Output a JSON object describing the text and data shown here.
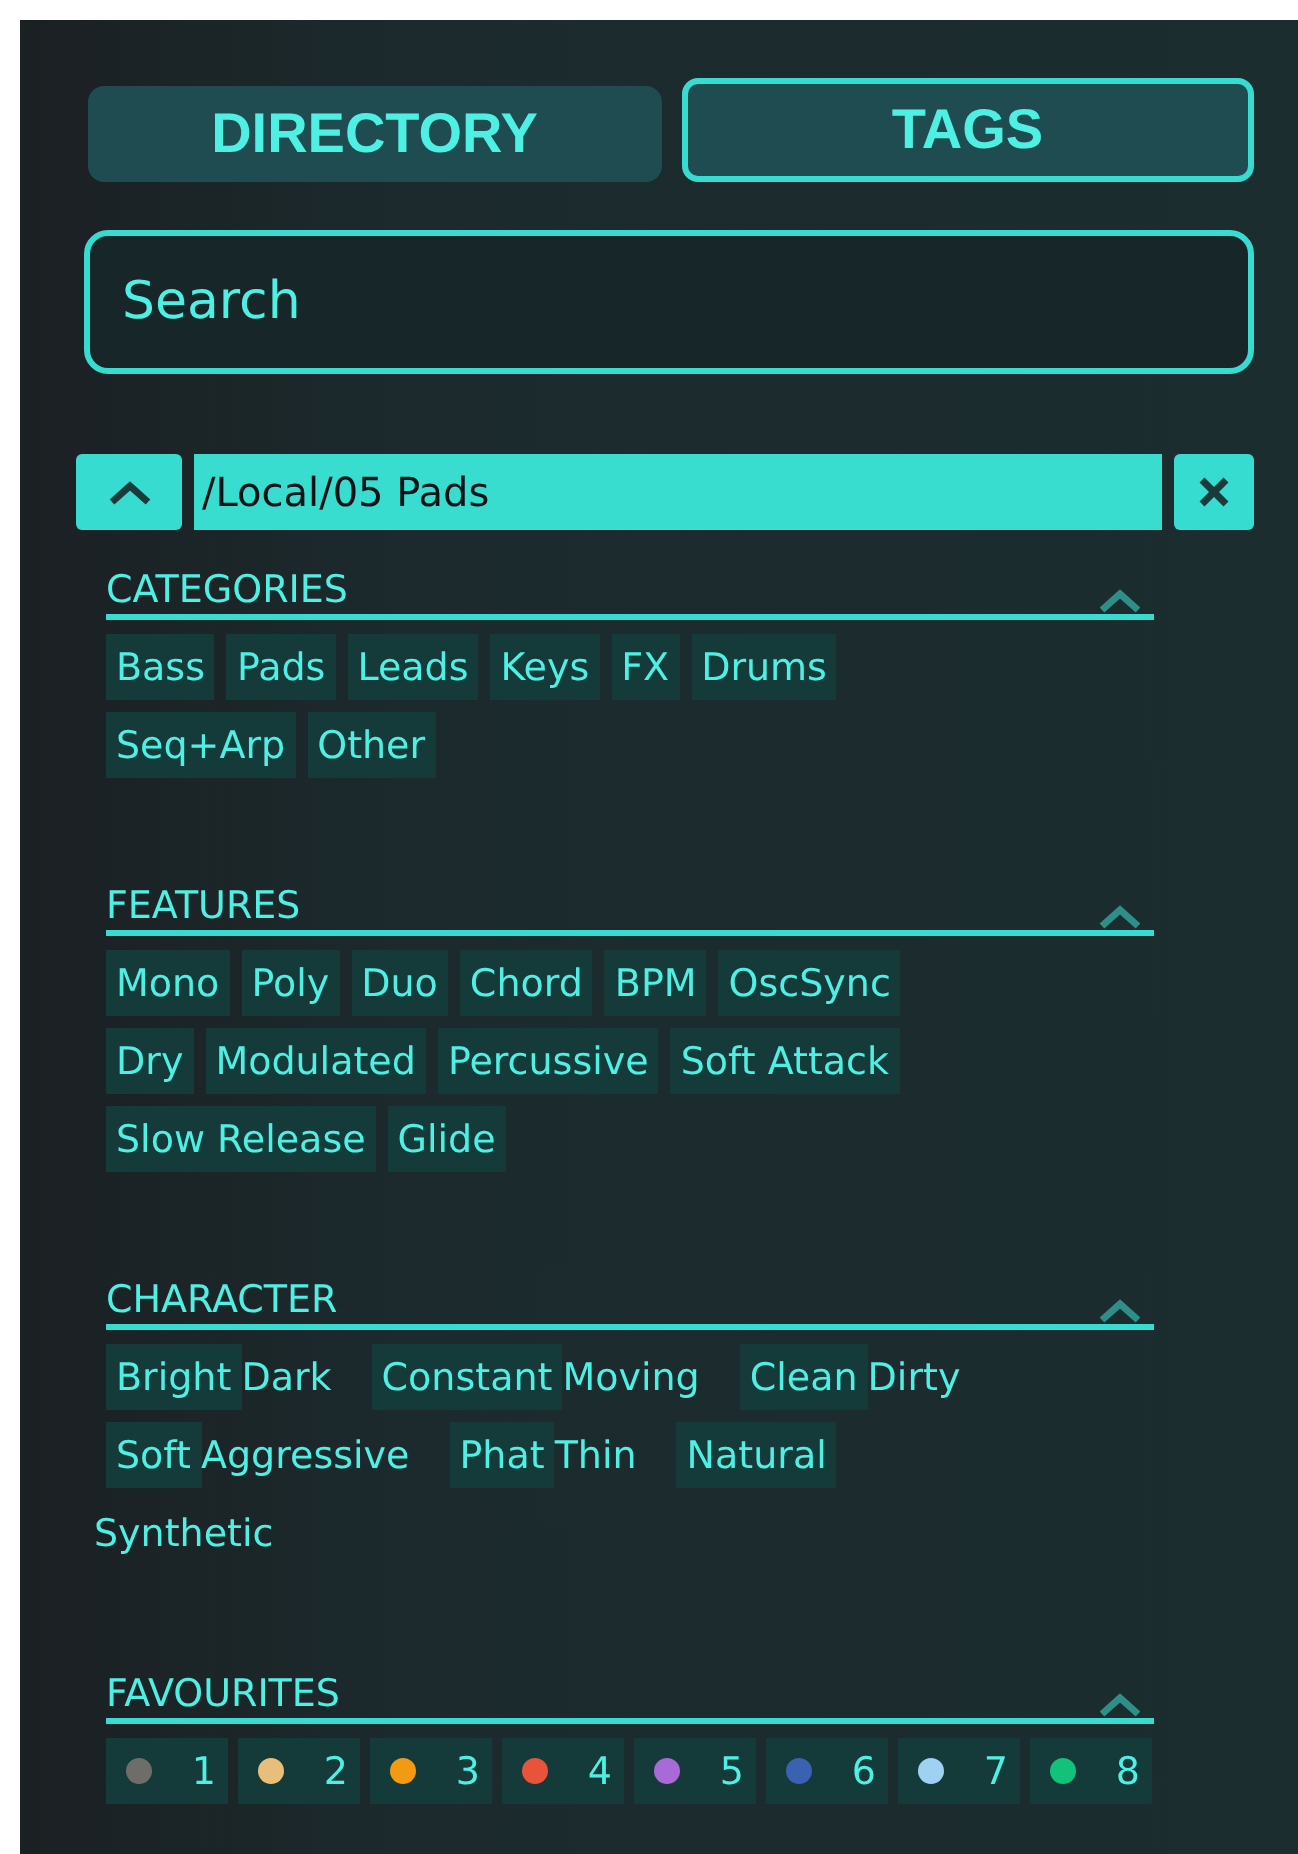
{
  "tabs": [
    {
      "label": "DIRECTORY",
      "selected": false
    },
    {
      "label": "TAGS",
      "selected": true
    }
  ],
  "search": {
    "placeholder": "Search"
  },
  "path": {
    "text": "/Local/05 Pads"
  },
  "sections": [
    {
      "title": "CATEGORIES",
      "expanded": true,
      "tags": [
        {
          "label": "Bass",
          "kind": "boxed"
        },
        {
          "label": "Pads",
          "kind": "boxed"
        },
        {
          "label": "Leads",
          "kind": "boxed"
        },
        {
          "label": "Keys",
          "kind": "boxed"
        },
        {
          "label": "FX",
          "kind": "boxed"
        },
        {
          "label": "Drums",
          "kind": "boxed"
        },
        {
          "label": "Seq+Arp",
          "kind": "boxed"
        },
        {
          "label": "Other",
          "kind": "boxed"
        }
      ]
    },
    {
      "title": "FEATURES",
      "expanded": true,
      "tags": [
        {
          "label": "Mono",
          "kind": "boxed"
        },
        {
          "label": "Poly",
          "kind": "boxed"
        },
        {
          "label": "Duo",
          "kind": "boxed"
        },
        {
          "label": "Chord",
          "kind": "boxed"
        },
        {
          "label": "BPM",
          "kind": "boxed"
        },
        {
          "label": "OscSync",
          "kind": "boxed"
        },
        {
          "label": "Dry",
          "kind": "boxed"
        },
        {
          "label": "Modulated",
          "kind": "boxed"
        },
        {
          "label": "Percussive",
          "kind": "boxed"
        },
        {
          "label": "Soft Attack",
          "kind": "boxed"
        },
        {
          "label": "Slow Release",
          "kind": "boxed"
        },
        {
          "label": "Glide",
          "kind": "boxed"
        }
      ]
    },
    {
      "title": "CHARACTER",
      "expanded": true,
      "tags": [
        {
          "label": "Bright",
          "kind": "boxed"
        },
        {
          "label": "Dark",
          "kind": "plain"
        },
        {
          "label": "Constant",
          "kind": "boxed"
        },
        {
          "label": "Moving",
          "kind": "plain"
        },
        {
          "label": "Clean",
          "kind": "boxed"
        },
        {
          "label": "Dirty",
          "kind": "plain"
        },
        {
          "label": "Soft",
          "kind": "boxed"
        },
        {
          "label": "Aggressive",
          "kind": "plain"
        },
        {
          "label": "Phat",
          "kind": "boxed"
        },
        {
          "label": "Thin",
          "kind": "plain"
        },
        {
          "label": "Natural",
          "kind": "boxed"
        },
        {
          "label": "Synthetic",
          "kind": "plain"
        }
      ]
    },
    {
      "title": "FAVOURITES",
      "expanded": true,
      "favourites": [
        {
          "label": "1",
          "color": "#6e6e68"
        },
        {
          "label": "2",
          "color": "#e8bf7a"
        },
        {
          "label": "3",
          "color": "#f29a12"
        },
        {
          "label": "4",
          "color": "#e8533c"
        },
        {
          "label": "5",
          "color": "#a86ad6"
        },
        {
          "label": "6",
          "color": "#3a62b0"
        },
        {
          "label": "7",
          "color": "#9fd2f2"
        },
        {
          "label": "8",
          "color": "#12c27a"
        }
      ]
    }
  ]
}
